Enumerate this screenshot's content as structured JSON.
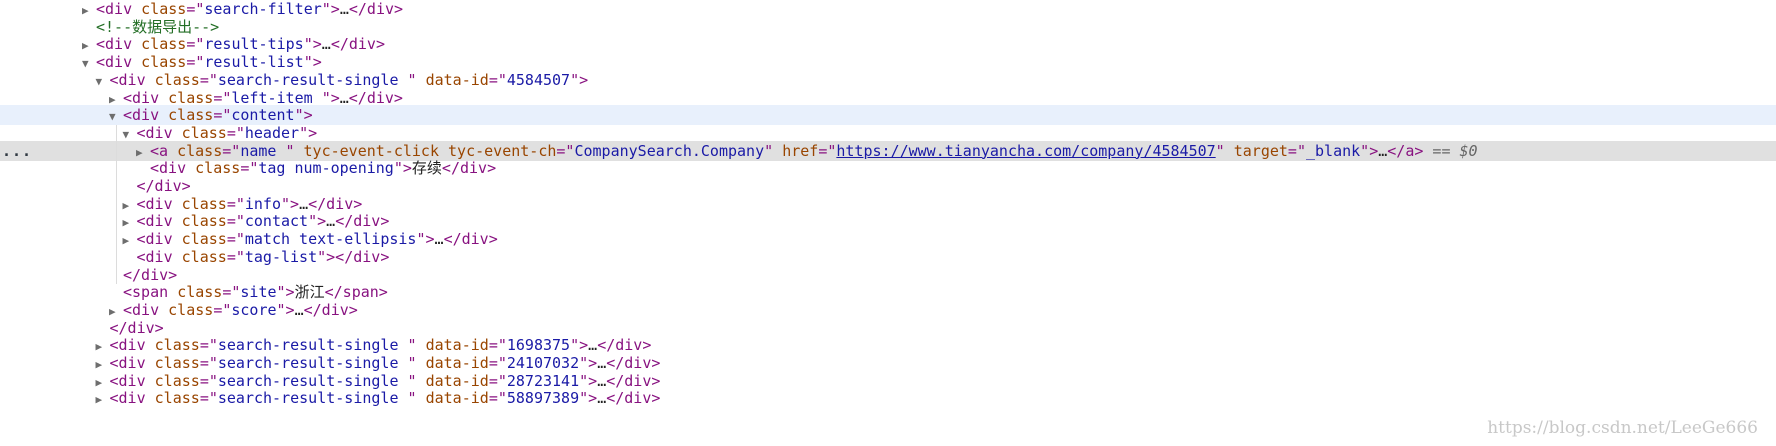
{
  "rows": [
    {
      "indent": 6,
      "arrow": "collapsed",
      "parts": [
        [
          "t",
          "<div "
        ],
        [
          "a",
          "class"
        ],
        [
          "t",
          "=\""
        ],
        [
          "v",
          "search-filter"
        ],
        [
          "t",
          "\">"
        ],
        [
          "x",
          "…"
        ],
        [
          "t",
          "</div>"
        ]
      ]
    },
    {
      "indent": 6,
      "arrow": "none",
      "parts": [
        [
          "c",
          "<!--数据导出-->"
        ]
      ]
    },
    {
      "indent": 6,
      "arrow": "collapsed",
      "parts": [
        [
          "t",
          "<div "
        ],
        [
          "a",
          "class"
        ],
        [
          "t",
          "=\""
        ],
        [
          "v",
          "result-tips"
        ],
        [
          "t",
          "\">"
        ],
        [
          "x",
          "…"
        ],
        [
          "t",
          "</div>"
        ]
      ]
    },
    {
      "indent": 6,
      "arrow": "expanded",
      "parts": [
        [
          "t",
          "<div "
        ],
        [
          "a",
          "class"
        ],
        [
          "t",
          "=\""
        ],
        [
          "v",
          "result-list"
        ],
        [
          "t",
          "\">"
        ]
      ]
    },
    {
      "indent": 7,
      "arrow": "expanded",
      "parts": [
        [
          "t",
          "<div "
        ],
        [
          "a",
          "class"
        ],
        [
          "t",
          "=\""
        ],
        [
          "v",
          "search-result-single "
        ],
        [
          "t",
          "\" "
        ],
        [
          "a",
          "data-id"
        ],
        [
          "t",
          "=\""
        ],
        [
          "v",
          "4584507"
        ],
        [
          "t",
          "\">"
        ]
      ]
    },
    {
      "indent": 8,
      "arrow": "collapsed",
      "parts": [
        [
          "t",
          "<div "
        ],
        [
          "a",
          "class"
        ],
        [
          "t",
          "=\""
        ],
        [
          "v",
          "left-item "
        ],
        [
          "t",
          "\">"
        ],
        [
          "x",
          "…"
        ],
        [
          "t",
          "</div>"
        ]
      ]
    },
    {
      "indent": 8,
      "arrow": "expanded",
      "state": "hover",
      "parts": [
        [
          "t",
          "<div "
        ],
        [
          "a",
          "class"
        ],
        [
          "t",
          "=\""
        ],
        [
          "v",
          "content"
        ],
        [
          "t",
          "\">"
        ]
      ]
    },
    {
      "indent": 9,
      "arrow": "expanded",
      "parts": [
        [
          "t",
          "<div "
        ],
        [
          "a",
          "class"
        ],
        [
          "t",
          "=\""
        ],
        [
          "v",
          "header"
        ],
        [
          "t",
          "\">"
        ]
      ]
    },
    {
      "indent": 10,
      "arrow": "collapsed",
      "state": "selected",
      "parts": [
        [
          "t",
          "<a "
        ],
        [
          "a",
          "class"
        ],
        [
          "t",
          "=\""
        ],
        [
          "v",
          "name "
        ],
        [
          "t",
          "\" "
        ],
        [
          "a",
          "tyc-event-click tyc-event-ch"
        ],
        [
          "t",
          "=\""
        ],
        [
          "v",
          "CompanySearch.Company"
        ],
        [
          "t",
          "\" "
        ],
        [
          "a",
          "href"
        ],
        [
          "t",
          "=\""
        ],
        [
          "l",
          "https://www.tianyancha.com/company/4584507"
        ],
        [
          "t",
          "\" "
        ],
        [
          "a",
          "target"
        ],
        [
          "t",
          "=\""
        ],
        [
          "v",
          "_blank"
        ],
        [
          "t",
          "\">"
        ],
        [
          "x",
          "…"
        ],
        [
          "t",
          "</a>"
        ],
        [
          "e",
          " == $0"
        ]
      ]
    },
    {
      "indent": 10,
      "arrow": "none",
      "parts": [
        [
          "t",
          "<div "
        ],
        [
          "a",
          "class"
        ],
        [
          "t",
          "=\""
        ],
        [
          "v",
          "tag num-opening"
        ],
        [
          "t",
          "\">"
        ],
        [
          "x",
          "存续"
        ],
        [
          "t",
          "</div>"
        ]
      ]
    },
    {
      "indent": 9,
      "arrow": "none",
      "parts": [
        [
          "t",
          "</div>"
        ]
      ]
    },
    {
      "indent": 9,
      "arrow": "collapsed",
      "parts": [
        [
          "t",
          "<div "
        ],
        [
          "a",
          "class"
        ],
        [
          "t",
          "=\""
        ],
        [
          "v",
          "info"
        ],
        [
          "t",
          "\">"
        ],
        [
          "x",
          "…"
        ],
        [
          "t",
          "</div>"
        ]
      ]
    },
    {
      "indent": 9,
      "arrow": "collapsed",
      "parts": [
        [
          "t",
          "<div "
        ],
        [
          "a",
          "class"
        ],
        [
          "t",
          "=\""
        ],
        [
          "v",
          "contact"
        ],
        [
          "t",
          "\">"
        ],
        [
          "x",
          "…"
        ],
        [
          "t",
          "</div>"
        ]
      ]
    },
    {
      "indent": 9,
      "arrow": "collapsed",
      "parts": [
        [
          "t",
          "<div "
        ],
        [
          "a",
          "class"
        ],
        [
          "t",
          "=\""
        ],
        [
          "v",
          "match text-ellipsis"
        ],
        [
          "t",
          "\">"
        ],
        [
          "x",
          "…"
        ],
        [
          "t",
          "</div>"
        ]
      ]
    },
    {
      "indent": 9,
      "arrow": "none",
      "parts": [
        [
          "t",
          "<div "
        ],
        [
          "a",
          "class"
        ],
        [
          "t",
          "=\""
        ],
        [
          "v",
          "tag-list"
        ],
        [
          "t",
          "\"></div>"
        ]
      ]
    },
    {
      "indent": 8,
      "arrow": "none",
      "parts": [
        [
          "t",
          "</div>"
        ]
      ]
    },
    {
      "indent": 8,
      "arrow": "none",
      "parts": [
        [
          "t",
          "<span "
        ],
        [
          "a",
          "class"
        ],
        [
          "t",
          "=\""
        ],
        [
          "v",
          "site"
        ],
        [
          "t",
          "\">"
        ],
        [
          "x",
          "浙江"
        ],
        [
          "t",
          "</span>"
        ]
      ]
    },
    {
      "indent": 8,
      "arrow": "collapsed",
      "parts": [
        [
          "t",
          "<div "
        ],
        [
          "a",
          "class"
        ],
        [
          "t",
          "=\""
        ],
        [
          "v",
          "score"
        ],
        [
          "t",
          "\">"
        ],
        [
          "x",
          "…"
        ],
        [
          "t",
          "</div>"
        ]
      ]
    },
    {
      "indent": 7,
      "arrow": "none",
      "parts": [
        [
          "t",
          "</div>"
        ]
      ]
    },
    {
      "indent": 7,
      "arrow": "collapsed",
      "parts": [
        [
          "t",
          "<div "
        ],
        [
          "a",
          "class"
        ],
        [
          "t",
          "=\""
        ],
        [
          "v",
          "search-result-single "
        ],
        [
          "t",
          "\" "
        ],
        [
          "a",
          "data-id"
        ],
        [
          "t",
          "=\""
        ],
        [
          "v",
          "1698375"
        ],
        [
          "t",
          "\">"
        ],
        [
          "x",
          "…"
        ],
        [
          "t",
          "</div>"
        ]
      ]
    },
    {
      "indent": 7,
      "arrow": "collapsed",
      "parts": [
        [
          "t",
          "<div "
        ],
        [
          "a",
          "class"
        ],
        [
          "t",
          "=\""
        ],
        [
          "v",
          "search-result-single "
        ],
        [
          "t",
          "\" "
        ],
        [
          "a",
          "data-id"
        ],
        [
          "t",
          "=\""
        ],
        [
          "v",
          "24107032"
        ],
        [
          "t",
          "\">"
        ],
        [
          "x",
          "…"
        ],
        [
          "t",
          "</div>"
        ]
      ]
    },
    {
      "indent": 7,
      "arrow": "collapsed",
      "parts": [
        [
          "t",
          "<div "
        ],
        [
          "a",
          "class"
        ],
        [
          "t",
          "=\""
        ],
        [
          "v",
          "search-result-single "
        ],
        [
          "t",
          "\" "
        ],
        [
          "a",
          "data-id"
        ],
        [
          "t",
          "=\""
        ],
        [
          "v",
          "28723141"
        ],
        [
          "t",
          "\">"
        ],
        [
          "x",
          "…"
        ],
        [
          "t",
          "</div>"
        ]
      ]
    },
    {
      "indent": 7,
      "arrow": "collapsed",
      "parts": [
        [
          "t",
          "<div "
        ],
        [
          "a",
          "class"
        ],
        [
          "t",
          "=\""
        ],
        [
          "v",
          "search-result-single "
        ],
        [
          "t",
          "\" "
        ],
        [
          "a",
          "data-id"
        ],
        [
          "t",
          "=\""
        ],
        [
          "v",
          "58897389"
        ],
        [
          "t",
          "\">"
        ],
        [
          "x",
          "…"
        ],
        [
          "t",
          "</div>"
        ]
      ]
    }
  ],
  "selected_row_marker": "...",
  "watermark": "https://blog.csdn.net/LeeGe666",
  "colors": {
    "tag": "#881280",
    "attribute": "#994500",
    "value": "#1a1aa6",
    "comment": "#236e25",
    "hover_row": "#e8f0fc",
    "selected_row": "#e0e0e0"
  }
}
